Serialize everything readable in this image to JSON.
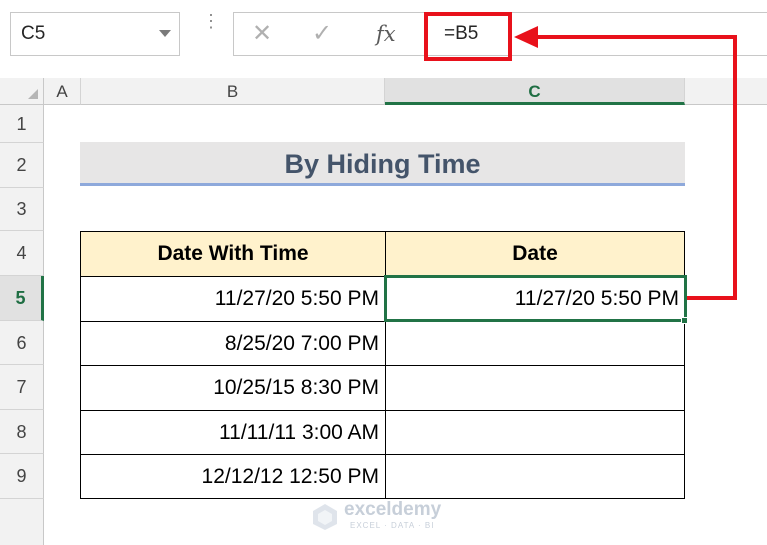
{
  "formula_bar": {
    "name_box": "C5",
    "dots": "⋮",
    "cancel_icon": "✕",
    "enter_icon": "✓",
    "function_icon": "fx",
    "formula": "=B5"
  },
  "columns": [
    "A",
    "B",
    "C"
  ],
  "rows": [
    "1",
    "2",
    "3",
    "4",
    "5",
    "6",
    "7",
    "8",
    "9"
  ],
  "selected_cell": "C5",
  "table": {
    "title": "By Hiding Time",
    "headers": [
      "Date With Time",
      "Date"
    ],
    "data_rows": [
      {
        "date_with_time": "11/27/20 5:50 PM",
        "date": "11/27/20 5:50 PM"
      },
      {
        "date_with_time": "8/25/20 7:00 PM",
        "date": ""
      },
      {
        "date_with_time": "10/25/15 8:30 PM",
        "date": ""
      },
      {
        "date_with_time": "11/11/11 3:00 AM",
        "date": ""
      },
      {
        "date_with_time": "12/12/12 12:50 PM",
        "date": ""
      }
    ]
  },
  "watermark": {
    "name": "exceldemy",
    "tagline": "EXCEL · DATA · BI"
  },
  "colors": {
    "accent_green": "#217346",
    "annotation_red": "#e8111b",
    "header_fill": "#fff2cc",
    "title_fill": "#e7e6e6"
  }
}
